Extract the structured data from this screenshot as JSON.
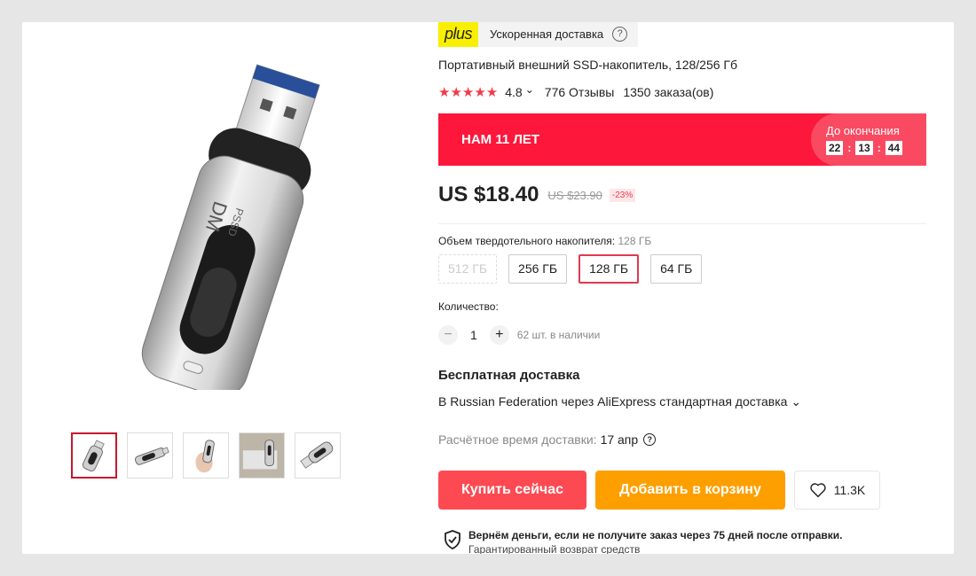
{
  "delivery_badge": {
    "plus": "plus",
    "label": "Ускоренная доставка",
    "help": "?"
  },
  "product": {
    "title": "Портативный внешний SSD-накопитель, 128/256 Гб",
    "rating": "4.8",
    "rating_stars": 5,
    "rating_chevron": "⌄",
    "reviews": "776 Отзывы",
    "orders": "1350 заказа(ов)",
    "image_brand": "DM",
    "image_model": "PSSD"
  },
  "promo": {
    "title": "НАМ 11 ЛЕТ",
    "timer_label": "До окончания",
    "hours": "22",
    "minutes": "13",
    "seconds": "44",
    "sep": ":"
  },
  "price": {
    "current": "US $18.40",
    "old": "US $23.90",
    "discount": "-23%"
  },
  "storage": {
    "label": "Объем твердотельного накопителя:",
    "selected": "128 ГБ",
    "options": [
      {
        "label": "512 ГБ",
        "state": "disabled"
      },
      {
        "label": "256 ГБ",
        "state": "normal"
      },
      {
        "label": "128 ГБ",
        "state": "selected"
      },
      {
        "label": "64 ГБ",
        "state": "normal"
      }
    ]
  },
  "quantity": {
    "label": "Количество:",
    "minus": "−",
    "value": "1",
    "plus": "+",
    "stock": "62 шт. в наличии"
  },
  "shipping": {
    "title": "Бесплатная доставка",
    "description": "В Russian Federation через AliExpress стандартная доставка ⌄",
    "estimate_label": "Расчётное время доставки:",
    "estimate_date": "17 апр",
    "help": "?"
  },
  "actions": {
    "buy_now": "Купить сейчас",
    "add_to_cart": "Добавить в корзину",
    "wishlist_count": "11.3K"
  },
  "guarantee": {
    "title": "Вернём деньги, если не получите заказ через 75 дней после отправки.",
    "subtitle": "Гарантированный возврат средств"
  },
  "gallery": {
    "thumbnail_count": 5,
    "active_index": 0
  },
  "colors": {
    "accent": "#fc173b",
    "buy": "#fd4a52",
    "cart": "#fe9f00",
    "plus_yellow": "#f8f000"
  }
}
